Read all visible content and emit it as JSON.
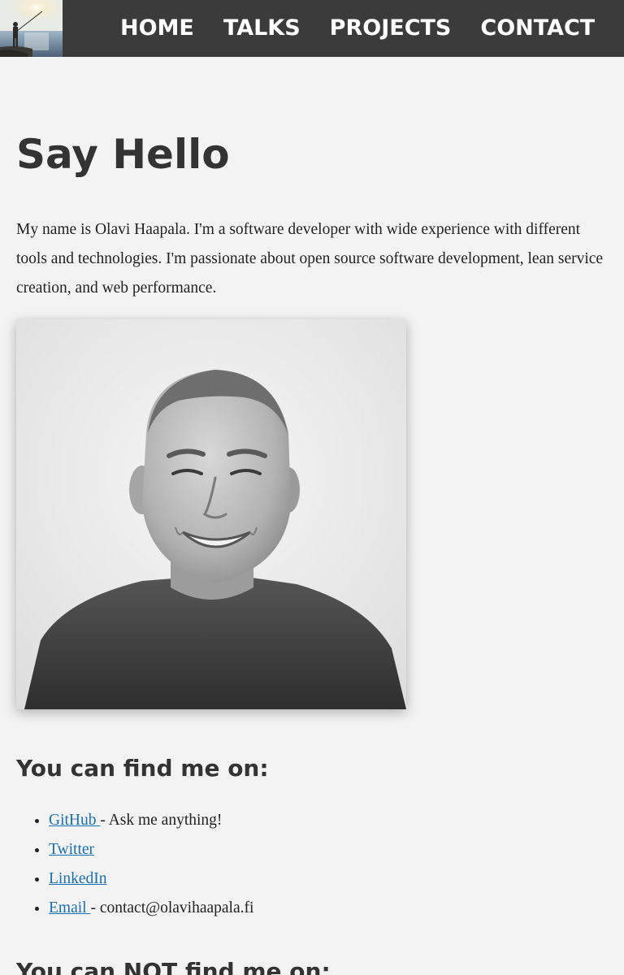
{
  "nav": {
    "items": [
      {
        "label": "HOME"
      },
      {
        "label": "TALKS"
      },
      {
        "label": "PROJECTS"
      },
      {
        "label": "CONTACT"
      }
    ]
  },
  "page": {
    "title": "Say Hello",
    "intro": "My name is Olavi Haapala. I'm a software developer with wide experience with different tools and technologies. I'm passionate about open source software development, lean service creation, and web performance."
  },
  "find": {
    "heading": "You can find me on:",
    "items": [
      {
        "link": "GitHub ",
        "note": "- Ask me anything!"
      },
      {
        "link": "Twitter",
        "note": ""
      },
      {
        "link": "LinkedIn",
        "note": ""
      },
      {
        "link": "Email ",
        "note": "- contact@olavihaapala.fi"
      }
    ]
  },
  "not_find": {
    "heading": "You can NOT find me on:"
  },
  "icons": {
    "logo": "fisherman-sunset-logo",
    "portrait": "profile-photo"
  }
}
